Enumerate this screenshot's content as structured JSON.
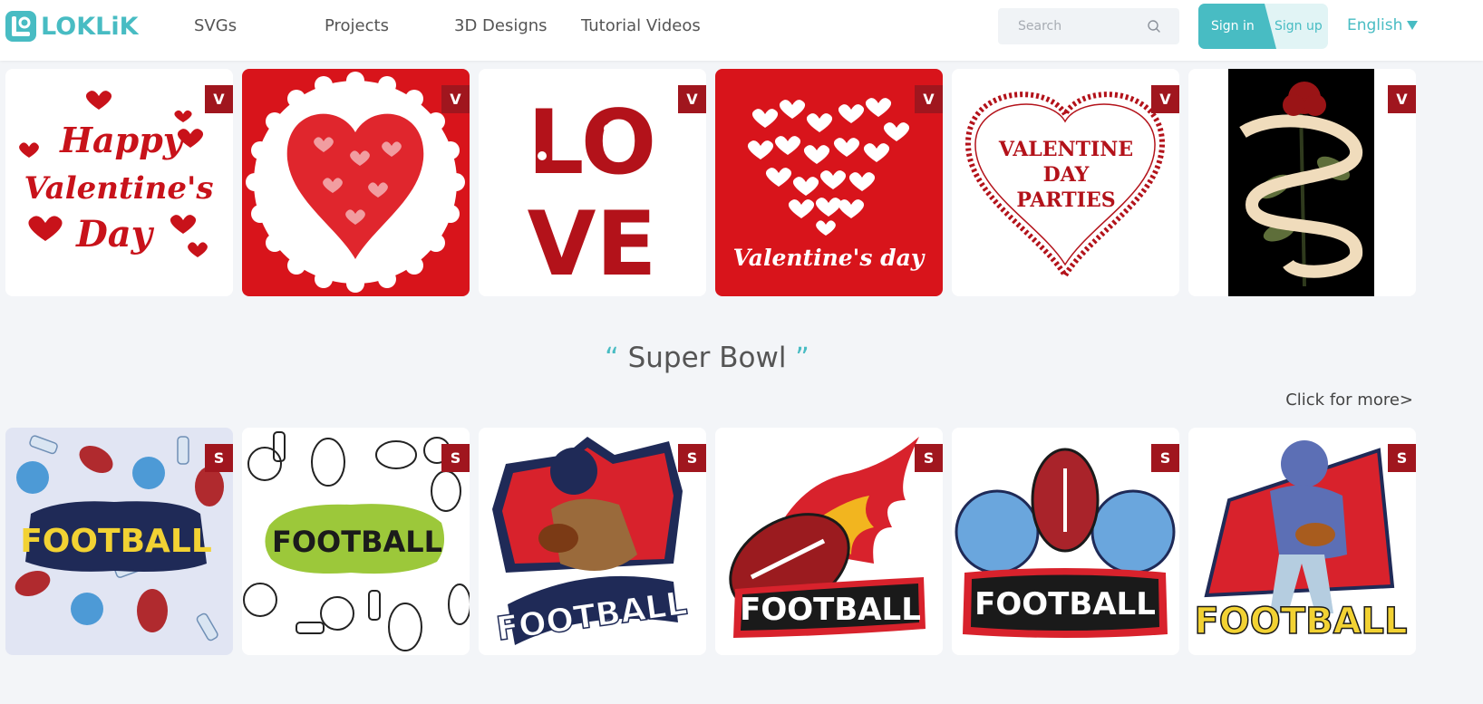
{
  "header": {
    "logo_text": "LOKLiK",
    "nav": [
      "SVGs",
      "Projects",
      "3D Designs",
      "Tutorial Videos"
    ],
    "search_placeholder": "Search",
    "signin_label": "Sign in",
    "signup_label": "Sign up",
    "language": "English"
  },
  "valentine_row": {
    "cards": [
      {
        "badge": "V",
        "art_text": [
          "Happy",
          "Valentine's",
          "Day"
        ]
      },
      {
        "badge": "V"
      },
      {
        "badge": "V",
        "art_text": [
          "LO",
          "VE"
        ]
      },
      {
        "badge": "V",
        "art_text": [
          "Valentine's day"
        ]
      },
      {
        "badge": "V",
        "art_text": [
          "VALENTINE",
          "DAY",
          "PARTIES"
        ]
      },
      {
        "badge": "V"
      }
    ]
  },
  "super_bowl": {
    "title_open_quote": "“",
    "title": "Super Bowl",
    "title_close_quote": "”",
    "more_link": "Click for more>",
    "cards": [
      {
        "badge": "S",
        "art_text": "FOOTBALL"
      },
      {
        "badge": "S",
        "art_text": "FOOTBALL"
      },
      {
        "badge": "S",
        "art_text": "FOOTBALL"
      },
      {
        "badge": "S",
        "art_text": "FOOTBALL"
      },
      {
        "badge": "S",
        "art_text": "FOOTBALL"
      },
      {
        "badge": "S",
        "art_text": "FOOTBALL"
      }
    ]
  },
  "colors": {
    "accent": "#48bcc3",
    "badge": "#a0161e",
    "valentine_red": "#d8141b",
    "page_bg": "#f3f5f8"
  }
}
